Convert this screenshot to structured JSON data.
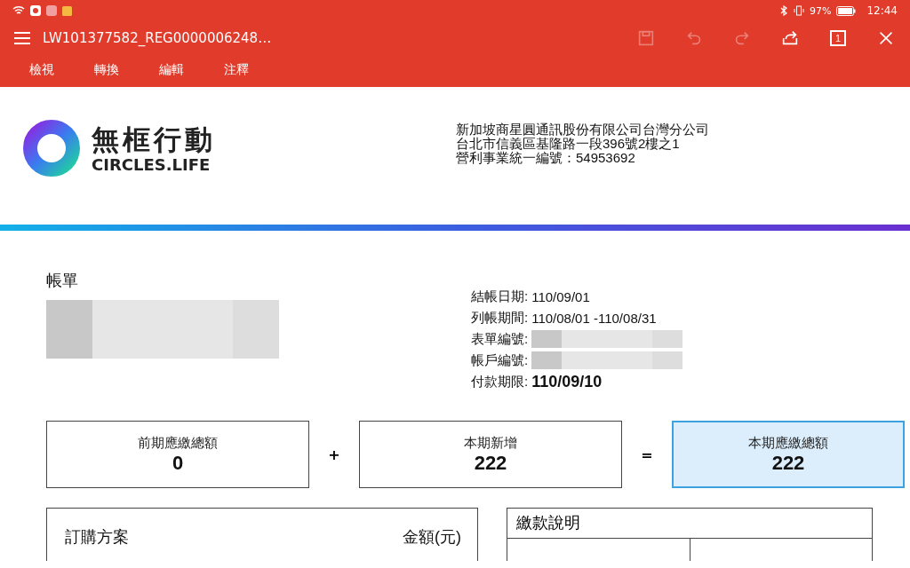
{
  "status_bar": {
    "battery": "97%",
    "time": "12:44"
  },
  "toolbar": {
    "title": "LW101377582_REG0000006248…",
    "actions": [
      {
        "kind": "save",
        "disabled": true
      },
      {
        "kind": "undo",
        "disabled": true
      },
      {
        "kind": "redo",
        "disabled": true
      },
      {
        "kind": "share",
        "disabled": false
      },
      {
        "kind": "page",
        "label": "1",
        "disabled": false
      },
      {
        "kind": "close",
        "disabled": false
      }
    ]
  },
  "menu": [
    {
      "label": "檢視"
    },
    {
      "label": "轉換"
    },
    {
      "label": "編輯"
    },
    {
      "label": "注釋"
    }
  ],
  "header": {
    "brand_cn": "無框行動",
    "brand_en": "CIRCLES.LIFE",
    "company": [
      "新加坡商星圓通訊股份有限公司台灣分公司",
      "台北市信義區基隆路一段396號2樓之1",
      "營利事業統一編號：54953692"
    ]
  },
  "bill": {
    "title": "帳單",
    "details": [
      {
        "kind": "plain",
        "label": "結帳日期:",
        "value": "110/09/01"
      },
      {
        "kind": "plain",
        "label": "列帳期間:",
        "value": "110/08/01 -110/08/31"
      },
      {
        "kind": "redacted",
        "label": "表單編號:"
      },
      {
        "kind": "redacted",
        "label": "帳戶編號:"
      },
      {
        "kind": "emphasis",
        "label": "付款期限:",
        "value": "110/09/10"
      }
    ]
  },
  "summary": [
    {
      "label": "前期應繳總額",
      "amount": "0",
      "highlighted": false,
      "operator": "+"
    },
    {
      "label": "本期新增",
      "amount": "222",
      "highlighted": false,
      "operator": "="
    },
    {
      "label": "本期應繳總額",
      "amount": "222",
      "highlighted": true
    }
  ],
  "plan_table": {
    "columns": [
      "訂購方案",
      "金額(元)"
    ]
  },
  "payment": {
    "title": "繳款說明"
  }
}
